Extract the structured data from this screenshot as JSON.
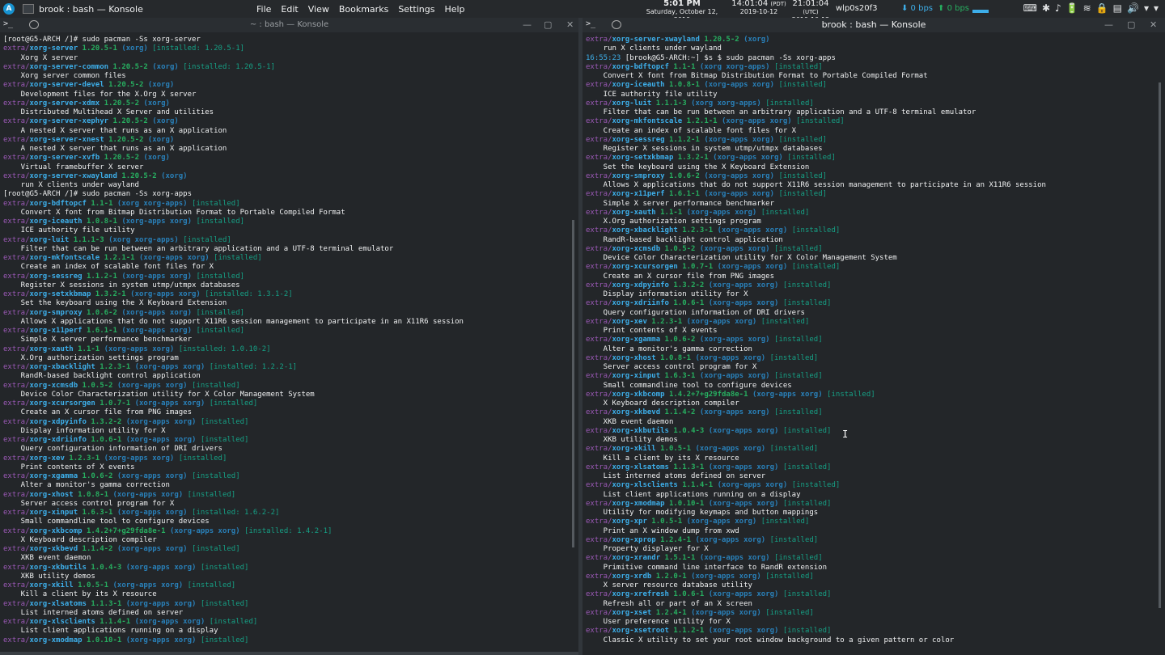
{
  "topbar": {
    "launcher": "A",
    "app_title": "brook : bash — Konsole",
    "menus": [
      "File",
      "Edit",
      "View",
      "Bookmarks",
      "Settings",
      "Help"
    ],
    "clock": {
      "time": "5:01 PM",
      "date": "Saturday, October 12, 2019"
    },
    "tz1": {
      "time": "14:01:04",
      "zone": "(PDT)",
      "date": "2019-10-12"
    },
    "tz2": {
      "time": "21:01:04",
      "zone": "(UTC)",
      "date": "2019-10-12"
    },
    "interface": "wlp0s20f3",
    "net_down": "⬇ 0 bps",
    "net_up": "⬆ 0 bps",
    "tray": [
      "⌨",
      "✱",
      "♪",
      "🔋",
      "≋",
      "🔒",
      "▤",
      "🔊",
      "▾",
      "▾"
    ]
  },
  "left_pane": {
    "title": "~ : bash — Konsole",
    "term_glyph": ">_",
    "controls": [
      "—",
      "▢",
      "✕"
    ],
    "lines": [
      {
        "t": "p",
        "p": "[root@G5-ARCH /]# sudo pacman -Ss xorg-server"
      },
      {
        "t": "pkg",
        "r": "extra/",
        "n": "xorg-server",
        "v": "1.20.5-1",
        "g": "(xorg)",
        "i": "[installed: 1.20.5-1]"
      },
      {
        "t": "d",
        "d": "    Xorg X server"
      },
      {
        "t": "pkg",
        "r": "extra/",
        "n": "xorg-server-common",
        "v": "1.20.5-2",
        "g": "(xorg)",
        "i": "[installed: 1.20.5-1]"
      },
      {
        "t": "d",
        "d": "    Xorg server common files"
      },
      {
        "t": "pkg",
        "r": "extra/",
        "n": "xorg-server-devel",
        "v": "1.20.5-2",
        "g": "(xorg)",
        "i": ""
      },
      {
        "t": "d",
        "d": "    Development files for the X.Org X server"
      },
      {
        "t": "pkg",
        "r": "extra/",
        "n": "xorg-server-xdmx",
        "v": "1.20.5-2",
        "g": "(xorg)",
        "i": ""
      },
      {
        "t": "d",
        "d": "    Distributed Multihead X Server and utilities"
      },
      {
        "t": "pkg",
        "r": "extra/",
        "n": "xorg-server-xephyr",
        "v": "1.20.5-2",
        "g": "(xorg)",
        "i": ""
      },
      {
        "t": "d",
        "d": "    A nested X server that runs as an X application"
      },
      {
        "t": "pkg",
        "r": "extra/",
        "n": "xorg-server-xnest",
        "v": "1.20.5-2",
        "g": "(xorg)",
        "i": ""
      },
      {
        "t": "d",
        "d": "    A nested X server that runs as an X application"
      },
      {
        "t": "pkg",
        "r": "extra/",
        "n": "xorg-server-xvfb",
        "v": "1.20.5-2",
        "g": "(xorg)",
        "i": ""
      },
      {
        "t": "d",
        "d": "    Virtual framebuffer X server"
      },
      {
        "t": "pkg",
        "r": "extra/",
        "n": "xorg-server-xwayland",
        "v": "1.20.5-2",
        "g": "(xorg)",
        "i": ""
      },
      {
        "t": "d",
        "d": "    run X clients under wayland"
      },
      {
        "t": "p",
        "p": "[root@G5-ARCH /]# sudo pacman -Ss xorg-apps"
      },
      {
        "t": "pkg",
        "r": "extra/",
        "n": "xorg-bdftopcf",
        "v": "1.1-1",
        "g": "(xorg xorg-apps)",
        "i": "[installed]"
      },
      {
        "t": "d",
        "d": "    Convert X font from Bitmap Distribution Format to Portable Compiled Format"
      },
      {
        "t": "pkg",
        "r": "extra/",
        "n": "xorg-iceauth",
        "v": "1.0.8-1",
        "g": "(xorg-apps xorg)",
        "i": "[installed]"
      },
      {
        "t": "d",
        "d": "    ICE authority file utility"
      },
      {
        "t": "pkg",
        "r": "extra/",
        "n": "xorg-luit",
        "v": "1.1.1-3",
        "g": "(xorg xorg-apps)",
        "i": "[installed]"
      },
      {
        "t": "d",
        "d": "    Filter that can be run between an arbitrary application and a UTF-8 terminal emulator"
      },
      {
        "t": "pkg",
        "r": "extra/",
        "n": "xorg-mkfontscale",
        "v": "1.2.1-1",
        "g": "(xorg-apps xorg)",
        "i": "[installed]"
      },
      {
        "t": "d",
        "d": "    Create an index of scalable font files for X"
      },
      {
        "t": "pkg",
        "r": "extra/",
        "n": "xorg-sessreg",
        "v": "1.1.2-1",
        "g": "(xorg-apps xorg)",
        "i": "[installed]"
      },
      {
        "t": "d",
        "d": "    Register X sessions in system utmp/utmpx databases"
      },
      {
        "t": "pkg",
        "r": "extra/",
        "n": "xorg-setxkbmap",
        "v": "1.3.2-1",
        "g": "(xorg-apps xorg)",
        "i": "[installed: 1.3.1-2]"
      },
      {
        "t": "d",
        "d": "    Set the keyboard using the X Keyboard Extension"
      },
      {
        "t": "pkg",
        "r": "extra/",
        "n": "xorg-smproxy",
        "v": "1.0.6-2",
        "g": "(xorg-apps xorg)",
        "i": "[installed]"
      },
      {
        "t": "d",
        "d": "    Allows X applications that do not support X11R6 session management to participate in an X11R6 session"
      },
      {
        "t": "pkg",
        "r": "extra/",
        "n": "xorg-x11perf",
        "v": "1.6.1-1",
        "g": "(xorg-apps xorg)",
        "i": "[installed]"
      },
      {
        "t": "d",
        "d": "    Simple X server performance benchmarker"
      },
      {
        "t": "pkg",
        "r": "extra/",
        "n": "xorg-xauth",
        "v": "1.1-1",
        "g": "(xorg-apps xorg)",
        "i": "[installed: 1.0.10-2]"
      },
      {
        "t": "d",
        "d": "    X.Org authorization settings program"
      },
      {
        "t": "pkg",
        "r": "extra/",
        "n": "xorg-xbacklight",
        "v": "1.2.3-1",
        "g": "(xorg-apps xorg)",
        "i": "[installed: 1.2.2-1]"
      },
      {
        "t": "d",
        "d": "    RandR-based backlight control application"
      },
      {
        "t": "pkg",
        "r": "extra/",
        "n": "xorg-xcmsdb",
        "v": "1.0.5-2",
        "g": "(xorg-apps xorg)",
        "i": "[installed]"
      },
      {
        "t": "d",
        "d": "    Device Color Characterization utility for X Color Management System"
      },
      {
        "t": "pkg",
        "r": "extra/",
        "n": "xorg-xcursorgen",
        "v": "1.0.7-1",
        "g": "(xorg-apps xorg)",
        "i": "[installed]"
      },
      {
        "t": "d",
        "d": "    Create an X cursor file from PNG images"
      },
      {
        "t": "pkg",
        "r": "extra/",
        "n": "xorg-xdpyinfo",
        "v": "1.3.2-2",
        "g": "(xorg-apps xorg)",
        "i": "[installed]"
      },
      {
        "t": "d",
        "d": "    Display information utility for X"
      },
      {
        "t": "pkg",
        "r": "extra/",
        "n": "xorg-xdriinfo",
        "v": "1.0.6-1",
        "g": "(xorg-apps xorg)",
        "i": "[installed]"
      },
      {
        "t": "d",
        "d": "    Query configuration information of DRI drivers"
      },
      {
        "t": "pkg",
        "r": "extra/",
        "n": "xorg-xev",
        "v": "1.2.3-1",
        "g": "(xorg-apps xorg)",
        "i": "[installed]"
      },
      {
        "t": "d",
        "d": "    Print contents of X events"
      },
      {
        "t": "pkg",
        "r": "extra/",
        "n": "xorg-xgamma",
        "v": "1.0.6-2",
        "g": "(xorg-apps xorg)",
        "i": "[installed]"
      },
      {
        "t": "d",
        "d": "    Alter a monitor's gamma correction"
      },
      {
        "t": "pkg",
        "r": "extra/",
        "n": "xorg-xhost",
        "v": "1.0.8-1",
        "g": "(xorg-apps xorg)",
        "i": "[installed]"
      },
      {
        "t": "d",
        "d": "    Server access control program for X"
      },
      {
        "t": "pkg",
        "r": "extra/",
        "n": "xorg-xinput",
        "v": "1.6.3-1",
        "g": "(xorg-apps xorg)",
        "i": "[installed: 1.6.2-2]"
      },
      {
        "t": "d",
        "d": "    Small commandline tool to configure devices"
      },
      {
        "t": "pkg",
        "r": "extra/",
        "n": "xorg-xkbcomp",
        "v": "1.4.2+7+g29fda8e-1",
        "g": "(xorg-apps xorg)",
        "i": "[installed: 1.4.2-1]"
      },
      {
        "t": "d",
        "d": "    X Keyboard description compiler"
      },
      {
        "t": "pkg",
        "r": "extra/",
        "n": "xorg-xkbevd",
        "v": "1.1.4-2",
        "g": "(xorg-apps xorg)",
        "i": "[installed]"
      },
      {
        "t": "d",
        "d": "    XKB event daemon"
      },
      {
        "t": "pkg",
        "r": "extra/",
        "n": "xorg-xkbutils",
        "v": "1.0.4-3",
        "g": "(xorg-apps xorg)",
        "i": "[installed]"
      },
      {
        "t": "d",
        "d": "    XKB utility demos"
      },
      {
        "t": "pkg",
        "r": "extra/",
        "n": "xorg-xkill",
        "v": "1.0.5-1",
        "g": "(xorg-apps xorg)",
        "i": "[installed]"
      },
      {
        "t": "d",
        "d": "    Kill a client by its X resource"
      },
      {
        "t": "pkg",
        "r": "extra/",
        "n": "xorg-xlsatoms",
        "v": "1.1.3-1",
        "g": "(xorg-apps xorg)",
        "i": "[installed]"
      },
      {
        "t": "d",
        "d": "    List interned atoms defined on server"
      },
      {
        "t": "pkg",
        "r": "extra/",
        "n": "xorg-xlsclients",
        "v": "1.1.4-1",
        "g": "(xorg-apps xorg)",
        "i": "[installed]"
      },
      {
        "t": "d",
        "d": "    List client applications running on a display"
      },
      {
        "t": "pkg",
        "r": "extra/",
        "n": "xorg-xmodmap",
        "v": "1.0.10-1",
        "g": "(xorg-apps xorg)",
        "i": "[installed]"
      }
    ]
  },
  "right_pane": {
    "title": "brook : bash — Konsole",
    "term_glyph": ">_",
    "controls": [
      "—",
      "▢",
      "✕"
    ],
    "lines": [
      {
        "t": "pkg",
        "r": "extra/",
        "n": "xorg-server-xwayland",
        "v": "1.20.5-2",
        "g": "(xorg)",
        "i": ""
      },
      {
        "t": "d",
        "d": "    run X clients under wayland"
      },
      {
        "t": "tp",
        "time": "16:55:23",
        "p": " [brook@G5-ARCH:~] $s $ sudo pacman -Ss xorg-apps"
      },
      {
        "t": "pkg",
        "r": "extra/",
        "n": "xorg-bdftopcf",
        "v": "1.1-1",
        "g": "(xorg xorg-apps)",
        "i": "[installed]"
      },
      {
        "t": "d",
        "d": "    Convert X font from Bitmap Distribution Format to Portable Compiled Format"
      },
      {
        "t": "pkg",
        "r": "extra/",
        "n": "xorg-iceauth",
        "v": "1.0.8-1",
        "g": "(xorg-apps xorg)",
        "i": "[installed]"
      },
      {
        "t": "d",
        "d": "    ICE authority file utility"
      },
      {
        "t": "pkg",
        "r": "extra/",
        "n": "xorg-luit",
        "v": "1.1.1-3",
        "g": "(xorg xorg-apps)",
        "i": "[installed]"
      },
      {
        "t": "d",
        "d": "    Filter that can be run between an arbitrary application and a UTF-8 terminal emulator"
      },
      {
        "t": "pkg",
        "r": "extra/",
        "n": "xorg-mkfontscale",
        "v": "1.2.1-1",
        "g": "(xorg-apps xorg)",
        "i": "[installed]"
      },
      {
        "t": "d",
        "d": "    Create an index of scalable font files for X"
      },
      {
        "t": "pkg",
        "r": "extra/",
        "n": "xorg-sessreg",
        "v": "1.1.2-1",
        "g": "(xorg-apps xorg)",
        "i": "[installed]"
      },
      {
        "t": "d",
        "d": "    Register X sessions in system utmp/utmpx databases"
      },
      {
        "t": "pkg",
        "r": "extra/",
        "n": "xorg-setxkbmap",
        "v": "1.3.2-1",
        "g": "(xorg-apps xorg)",
        "i": "[installed]"
      },
      {
        "t": "d",
        "d": "    Set the keyboard using the X Keyboard Extension"
      },
      {
        "t": "pkg",
        "r": "extra/",
        "n": "xorg-smproxy",
        "v": "1.0.6-2",
        "g": "(xorg-apps xorg)",
        "i": "[installed]"
      },
      {
        "t": "d",
        "d": "    Allows X applications that do not support X11R6 session management to participate in an X11R6 session"
      },
      {
        "t": "pkg",
        "r": "extra/",
        "n": "xorg-x11perf",
        "v": "1.6.1-1",
        "g": "(xorg-apps xorg)",
        "i": "[installed]"
      },
      {
        "t": "d",
        "d": "    Simple X server performance benchmarker"
      },
      {
        "t": "pkg",
        "r": "extra/",
        "n": "xorg-xauth",
        "v": "1.1-1",
        "g": "(xorg-apps xorg)",
        "i": "[installed]"
      },
      {
        "t": "d",
        "d": "    X.Org authorization settings program"
      },
      {
        "t": "pkg",
        "r": "extra/",
        "n": "xorg-xbacklight",
        "v": "1.2.3-1",
        "g": "(xorg-apps xorg)",
        "i": "[installed]"
      },
      {
        "t": "d",
        "d": "    RandR-based backlight control application"
      },
      {
        "t": "pkg",
        "r": "extra/",
        "n": "xorg-xcmsdb",
        "v": "1.0.5-2",
        "g": "(xorg-apps xorg)",
        "i": "[installed]"
      },
      {
        "t": "d",
        "d": "    Device Color Characterization utility for X Color Management System"
      },
      {
        "t": "pkg",
        "r": "extra/",
        "n": "xorg-xcursorgen",
        "v": "1.0.7-1",
        "g": "(xorg-apps xorg)",
        "i": "[installed]"
      },
      {
        "t": "d",
        "d": "    Create an X cursor file from PNG images"
      },
      {
        "t": "pkg",
        "r": "extra/",
        "n": "xorg-xdpyinfo",
        "v": "1.3.2-2",
        "g": "(xorg-apps xorg)",
        "i": "[installed]"
      },
      {
        "t": "d",
        "d": "    Display information utility for X"
      },
      {
        "t": "pkg",
        "r": "extra/",
        "n": "xorg-xdriinfo",
        "v": "1.0.6-1",
        "g": "(xorg-apps xorg)",
        "i": "[installed]"
      },
      {
        "t": "d",
        "d": "    Query configuration information of DRI drivers"
      },
      {
        "t": "pkg",
        "r": "extra/",
        "n": "xorg-xev",
        "v": "1.2.3-1",
        "g": "(xorg-apps xorg)",
        "i": "[installed]"
      },
      {
        "t": "d",
        "d": "    Print contents of X events"
      },
      {
        "t": "pkg",
        "r": "extra/",
        "n": "xorg-xgamma",
        "v": "1.0.6-2",
        "g": "(xorg-apps xorg)",
        "i": "[installed]"
      },
      {
        "t": "d",
        "d": "    Alter a monitor's gamma correction"
      },
      {
        "t": "pkg",
        "r": "extra/",
        "n": "xorg-xhost",
        "v": "1.0.8-1",
        "g": "(xorg-apps xorg)",
        "i": "[installed]"
      },
      {
        "t": "d",
        "d": "    Server access control program for X"
      },
      {
        "t": "pkg",
        "r": "extra/",
        "n": "xorg-xinput",
        "v": "1.6.3-1",
        "g": "(xorg-apps xorg)",
        "i": "[installed]"
      },
      {
        "t": "d",
        "d": "    Small commandline tool to configure devices"
      },
      {
        "t": "pkg",
        "r": "extra/",
        "n": "xorg-xkbcomp",
        "v": "1.4.2+7+g29fda8e-1",
        "g": "(xorg-apps xorg)",
        "i": "[installed]"
      },
      {
        "t": "d",
        "d": "    X Keyboard description compiler"
      },
      {
        "t": "pkg",
        "r": "extra/",
        "n": "xorg-xkbevd",
        "v": "1.1.4-2",
        "g": "(xorg-apps xorg)",
        "i": "[installed]"
      },
      {
        "t": "d",
        "d": "    XKB event daemon"
      },
      {
        "t": "pkg",
        "r": "extra/",
        "n": "xorg-xkbutils",
        "v": "1.0.4-3",
        "g": "(xorg-apps xorg)",
        "i": "[installed]"
      },
      {
        "t": "d",
        "d": "    XKB utility demos"
      },
      {
        "t": "pkg",
        "r": "extra/",
        "n": "xorg-xkill",
        "v": "1.0.5-1",
        "g": "(xorg-apps xorg)",
        "i": "[installed]"
      },
      {
        "t": "d",
        "d": "    Kill a client by its X resource"
      },
      {
        "t": "pkg",
        "r": "extra/",
        "n": "xorg-xlsatoms",
        "v": "1.1.3-1",
        "g": "(xorg-apps xorg)",
        "i": "[installed]"
      },
      {
        "t": "d",
        "d": "    List interned atoms defined on server"
      },
      {
        "t": "pkg",
        "r": "extra/",
        "n": "xorg-xlsclients",
        "v": "1.1.4-1",
        "g": "(xorg-apps xorg)",
        "i": "[installed]"
      },
      {
        "t": "d",
        "d": "    List client applications running on a display"
      },
      {
        "t": "pkg",
        "r": "extra/",
        "n": "xorg-xmodmap",
        "v": "1.0.10-1",
        "g": "(xorg-apps xorg)",
        "i": "[installed]"
      },
      {
        "t": "d",
        "d": "    Utility for modifying keymaps and button mappings"
      },
      {
        "t": "pkg",
        "r": "extra/",
        "n": "xorg-xpr",
        "v": "1.0.5-1",
        "g": "(xorg-apps xorg)",
        "i": "[installed]"
      },
      {
        "t": "d",
        "d": "    Print an X window dump from xwd"
      },
      {
        "t": "pkg",
        "r": "extra/",
        "n": "xorg-xprop",
        "v": "1.2.4-1",
        "g": "(xorg-apps xorg)",
        "i": "[installed]"
      },
      {
        "t": "d",
        "d": "    Property displayer for X"
      },
      {
        "t": "pkg",
        "r": "extra/",
        "n": "xorg-xrandr",
        "v": "1.5.1-1",
        "g": "(xorg-apps xorg)",
        "i": "[installed]"
      },
      {
        "t": "d",
        "d": "    Primitive command line interface to RandR extension"
      },
      {
        "t": "pkg",
        "r": "extra/",
        "n": "xorg-xrdb",
        "v": "1.2.0-1",
        "g": "(xorg-apps xorg)",
        "i": "[installed]"
      },
      {
        "t": "d",
        "d": "    X server resource database utility"
      },
      {
        "t": "pkg",
        "r": "extra/",
        "n": "xorg-xrefresh",
        "v": "1.0.6-1",
        "g": "(xorg-apps xorg)",
        "i": "[installed]"
      },
      {
        "t": "d",
        "d": "    Refresh all or part of an X screen"
      },
      {
        "t": "pkg",
        "r": "extra/",
        "n": "xorg-xset",
        "v": "1.2.4-1",
        "g": "(xorg-apps xorg)",
        "i": "[installed]"
      },
      {
        "t": "d",
        "d": "    User preference utility for X"
      },
      {
        "t": "pkg",
        "r": "extra/",
        "n": "xorg-xsetroot",
        "v": "1.1.2-1",
        "g": "(xorg-apps xorg)",
        "i": "[installed]"
      },
      {
        "t": "d",
        "d": "    Classic X utility to set your root window background to a given pattern or color"
      }
    ]
  },
  "cursor_glyph": "I"
}
